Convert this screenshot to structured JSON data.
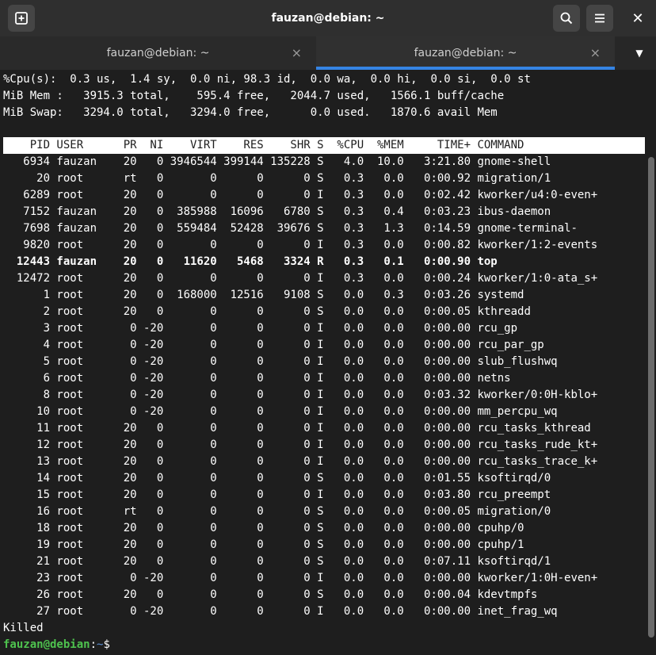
{
  "window": {
    "title": "fauzan@debian: ~",
    "new_tab_icon": "plus-box-icon",
    "search_icon": "magnifier-icon",
    "menu_icon": "hamburger-icon",
    "close_label": "✕"
  },
  "tabs": [
    {
      "label": "fauzan@debian: ~",
      "close": "×",
      "active": false
    },
    {
      "label": "fauzan@debian: ~",
      "close": "×",
      "active": true
    }
  ],
  "tabs_menu_label": "▼",
  "summary": {
    "cpu": "%Cpu(s):  0.3 us,  1.4 sy,  0.0 ni, 98.3 id,  0.0 wa,  0.0 hi,  0.0 si,  0.0 st",
    "mem": "MiB Mem :   3915.3 total,    595.4 free,   2044.7 used,   1566.1 buff/cache",
    "swap": "MiB Swap:   3294.0 total,   3294.0 free,      0.0 used.   1870.6 avail Mem"
  },
  "table": {
    "header": "    PID USER      PR  NI    VIRT    RES    SHR S  %CPU  %MEM     TIME+ COMMAND",
    "rows": [
      "   6934 fauzan    20   0 3946544 399144 135228 S   4.0  10.0   3:21.80 gnome-shell",
      "     20 root      rt   0       0      0      0 S   0.3   0.0   0:00.92 migration/1",
      "   6289 root      20   0       0      0      0 I   0.3   0.0   0:02.42 kworker/u4:0-even+",
      "   7152 fauzan    20   0  385988  16096   6780 S   0.3   0.4   0:03.23 ibus-daemon",
      "   7698 fauzan    20   0  559484  52428  39676 S   0.3   1.3   0:14.59 gnome-terminal-",
      "   9820 root      20   0       0      0      0 I   0.3   0.0   0:00.82 kworker/1:2-events",
      "  12443 fauzan    20   0   11620   5468   3324 R   0.3   0.1   0:00.90 top",
      "  12472 root      20   0       0      0      0 I   0.3   0.0   0:00.24 kworker/1:0-ata_s+",
      "      1 root      20   0  168000  12516   9108 S   0.0   0.3   0:03.26 systemd",
      "      2 root      20   0       0      0      0 S   0.0   0.0   0:00.05 kthreadd",
      "      3 root       0 -20       0      0      0 I   0.0   0.0   0:00.00 rcu_gp",
      "      4 root       0 -20       0      0      0 I   0.0   0.0   0:00.00 rcu_par_gp",
      "      5 root       0 -20       0      0      0 I   0.0   0.0   0:00.00 slub_flushwq",
      "      6 root       0 -20       0      0      0 I   0.0   0.0   0:00.00 netns",
      "      8 root       0 -20       0      0      0 I   0.0   0.0   0:03.32 kworker/0:0H-kblo+",
      "     10 root       0 -20       0      0      0 I   0.0   0.0   0:00.00 mm_percpu_wq",
      "     11 root      20   0       0      0      0 I   0.0   0.0   0:00.00 rcu_tasks_kthread",
      "     12 root      20   0       0      0      0 I   0.0   0.0   0:00.00 rcu_tasks_rude_kt+",
      "     13 root      20   0       0      0      0 I   0.0   0.0   0:00.00 rcu_tasks_trace_k+",
      "     14 root      20   0       0      0      0 S   0.0   0.0   0:01.55 ksoftirqd/0",
      "     15 root      20   0       0      0      0 I   0.0   0.0   0:03.80 rcu_preempt",
      "     16 root      rt   0       0      0      0 S   0.0   0.0   0:00.05 migration/0",
      "     18 root      20   0       0      0      0 S   0.0   0.0   0:00.00 cpuhp/0",
      "     19 root      20   0       0      0      0 S   0.0   0.0   0:00.00 cpuhp/1",
      "     21 root      20   0       0      0      0 S   0.0   0.0   0:07.11 ksoftirqd/1",
      "     23 root       0 -20       0      0      0 I   0.0   0.0   0:00.00 kworker/1:0H-even+",
      "     26 root      20   0       0      0      0 S   0.0   0.0   0:00.04 kdevtmpfs",
      "     27 root       0 -20       0      0      0 I   0.0   0.0   0:00.00 inet_frag_wq"
    ],
    "bold_row_index": 6
  },
  "footer": {
    "killed": "Killed",
    "prompt_user": "fauzan@debian",
    "prompt_sep": ":",
    "prompt_path": "~",
    "prompt_symbol": "$"
  },
  "colors": {
    "prompt_user": "#4ec24e",
    "prompt_path": "#5b8fd6",
    "tab_indicator": "#3584e4"
  }
}
